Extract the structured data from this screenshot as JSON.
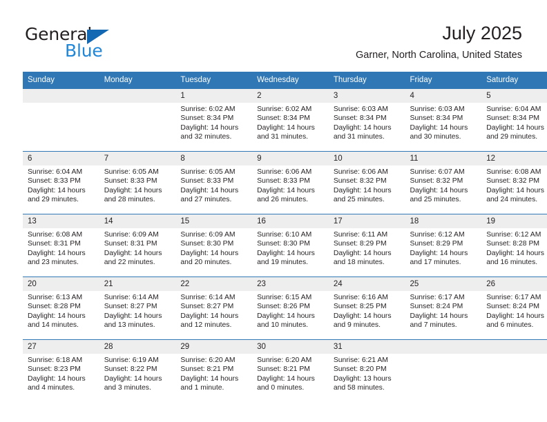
{
  "brand": {
    "word1": "General",
    "word2": "Blue",
    "triangle_color": "#1268b3",
    "blue_color": "#1f86d8"
  },
  "header": {
    "title": "July 2025",
    "subtitle": "Garner, North Carolina, United States"
  },
  "theme": {
    "header_blue": "#3077b5",
    "daynum_gray": "#eeeeee",
    "text": "#231f20"
  },
  "weekday_headers": [
    "Sunday",
    "Monday",
    "Tuesday",
    "Wednesday",
    "Thursday",
    "Friday",
    "Saturday"
  ],
  "weeks": [
    [
      {
        "day": "",
        "sunrise": "",
        "sunset": "",
        "daylight1": "",
        "daylight2": ""
      },
      {
        "day": "",
        "sunrise": "",
        "sunset": "",
        "daylight1": "",
        "daylight2": ""
      },
      {
        "day": "1",
        "sunrise": "Sunrise: 6:02 AM",
        "sunset": "Sunset: 8:34 PM",
        "daylight1": "Daylight: 14 hours",
        "daylight2": "and 32 minutes."
      },
      {
        "day": "2",
        "sunrise": "Sunrise: 6:02 AM",
        "sunset": "Sunset: 8:34 PM",
        "daylight1": "Daylight: 14 hours",
        "daylight2": "and 31 minutes."
      },
      {
        "day": "3",
        "sunrise": "Sunrise: 6:03 AM",
        "sunset": "Sunset: 8:34 PM",
        "daylight1": "Daylight: 14 hours",
        "daylight2": "and 31 minutes."
      },
      {
        "day": "4",
        "sunrise": "Sunrise: 6:03 AM",
        "sunset": "Sunset: 8:34 PM",
        "daylight1": "Daylight: 14 hours",
        "daylight2": "and 30 minutes."
      },
      {
        "day": "5",
        "sunrise": "Sunrise: 6:04 AM",
        "sunset": "Sunset: 8:34 PM",
        "daylight1": "Daylight: 14 hours",
        "daylight2": "and 29 minutes."
      }
    ],
    [
      {
        "day": "6",
        "sunrise": "Sunrise: 6:04 AM",
        "sunset": "Sunset: 8:33 PM",
        "daylight1": "Daylight: 14 hours",
        "daylight2": "and 29 minutes."
      },
      {
        "day": "7",
        "sunrise": "Sunrise: 6:05 AM",
        "sunset": "Sunset: 8:33 PM",
        "daylight1": "Daylight: 14 hours",
        "daylight2": "and 28 minutes."
      },
      {
        "day": "8",
        "sunrise": "Sunrise: 6:05 AM",
        "sunset": "Sunset: 8:33 PM",
        "daylight1": "Daylight: 14 hours",
        "daylight2": "and 27 minutes."
      },
      {
        "day": "9",
        "sunrise": "Sunrise: 6:06 AM",
        "sunset": "Sunset: 8:33 PM",
        "daylight1": "Daylight: 14 hours",
        "daylight2": "and 26 minutes."
      },
      {
        "day": "10",
        "sunrise": "Sunrise: 6:06 AM",
        "sunset": "Sunset: 8:32 PM",
        "daylight1": "Daylight: 14 hours",
        "daylight2": "and 25 minutes."
      },
      {
        "day": "11",
        "sunrise": "Sunrise: 6:07 AM",
        "sunset": "Sunset: 8:32 PM",
        "daylight1": "Daylight: 14 hours",
        "daylight2": "and 25 minutes."
      },
      {
        "day": "12",
        "sunrise": "Sunrise: 6:08 AM",
        "sunset": "Sunset: 8:32 PM",
        "daylight1": "Daylight: 14 hours",
        "daylight2": "and 24 minutes."
      }
    ],
    [
      {
        "day": "13",
        "sunrise": "Sunrise: 6:08 AM",
        "sunset": "Sunset: 8:31 PM",
        "daylight1": "Daylight: 14 hours",
        "daylight2": "and 23 minutes."
      },
      {
        "day": "14",
        "sunrise": "Sunrise: 6:09 AM",
        "sunset": "Sunset: 8:31 PM",
        "daylight1": "Daylight: 14 hours",
        "daylight2": "and 22 minutes."
      },
      {
        "day": "15",
        "sunrise": "Sunrise: 6:09 AM",
        "sunset": "Sunset: 8:30 PM",
        "daylight1": "Daylight: 14 hours",
        "daylight2": "and 20 minutes."
      },
      {
        "day": "16",
        "sunrise": "Sunrise: 6:10 AM",
        "sunset": "Sunset: 8:30 PM",
        "daylight1": "Daylight: 14 hours",
        "daylight2": "and 19 minutes."
      },
      {
        "day": "17",
        "sunrise": "Sunrise: 6:11 AM",
        "sunset": "Sunset: 8:29 PM",
        "daylight1": "Daylight: 14 hours",
        "daylight2": "and 18 minutes."
      },
      {
        "day": "18",
        "sunrise": "Sunrise: 6:12 AM",
        "sunset": "Sunset: 8:29 PM",
        "daylight1": "Daylight: 14 hours",
        "daylight2": "and 17 minutes."
      },
      {
        "day": "19",
        "sunrise": "Sunrise: 6:12 AM",
        "sunset": "Sunset: 8:28 PM",
        "daylight1": "Daylight: 14 hours",
        "daylight2": "and 16 minutes."
      }
    ],
    [
      {
        "day": "20",
        "sunrise": "Sunrise: 6:13 AM",
        "sunset": "Sunset: 8:28 PM",
        "daylight1": "Daylight: 14 hours",
        "daylight2": "and 14 minutes."
      },
      {
        "day": "21",
        "sunrise": "Sunrise: 6:14 AM",
        "sunset": "Sunset: 8:27 PM",
        "daylight1": "Daylight: 14 hours",
        "daylight2": "and 13 minutes."
      },
      {
        "day": "22",
        "sunrise": "Sunrise: 6:14 AM",
        "sunset": "Sunset: 8:27 PM",
        "daylight1": "Daylight: 14 hours",
        "daylight2": "and 12 minutes."
      },
      {
        "day": "23",
        "sunrise": "Sunrise: 6:15 AM",
        "sunset": "Sunset: 8:26 PM",
        "daylight1": "Daylight: 14 hours",
        "daylight2": "and 10 minutes."
      },
      {
        "day": "24",
        "sunrise": "Sunrise: 6:16 AM",
        "sunset": "Sunset: 8:25 PM",
        "daylight1": "Daylight: 14 hours",
        "daylight2": "and 9 minutes."
      },
      {
        "day": "25",
        "sunrise": "Sunrise: 6:17 AM",
        "sunset": "Sunset: 8:24 PM",
        "daylight1": "Daylight: 14 hours",
        "daylight2": "and 7 minutes."
      },
      {
        "day": "26",
        "sunrise": "Sunrise: 6:17 AM",
        "sunset": "Sunset: 8:24 PM",
        "daylight1": "Daylight: 14 hours",
        "daylight2": "and 6 minutes."
      }
    ],
    [
      {
        "day": "27",
        "sunrise": "Sunrise: 6:18 AM",
        "sunset": "Sunset: 8:23 PM",
        "daylight1": "Daylight: 14 hours",
        "daylight2": "and 4 minutes."
      },
      {
        "day": "28",
        "sunrise": "Sunrise: 6:19 AM",
        "sunset": "Sunset: 8:22 PM",
        "daylight1": "Daylight: 14 hours",
        "daylight2": "and 3 minutes."
      },
      {
        "day": "29",
        "sunrise": "Sunrise: 6:20 AM",
        "sunset": "Sunset: 8:21 PM",
        "daylight1": "Daylight: 14 hours",
        "daylight2": "and 1 minute."
      },
      {
        "day": "30",
        "sunrise": "Sunrise: 6:20 AM",
        "sunset": "Sunset: 8:21 PM",
        "daylight1": "Daylight: 14 hours",
        "daylight2": "and 0 minutes."
      },
      {
        "day": "31",
        "sunrise": "Sunrise: 6:21 AM",
        "sunset": "Sunset: 8:20 PM",
        "daylight1": "Daylight: 13 hours",
        "daylight2": "and 58 minutes."
      },
      {
        "day": "",
        "sunrise": "",
        "sunset": "",
        "daylight1": "",
        "daylight2": ""
      },
      {
        "day": "",
        "sunrise": "",
        "sunset": "",
        "daylight1": "",
        "daylight2": ""
      }
    ]
  ]
}
